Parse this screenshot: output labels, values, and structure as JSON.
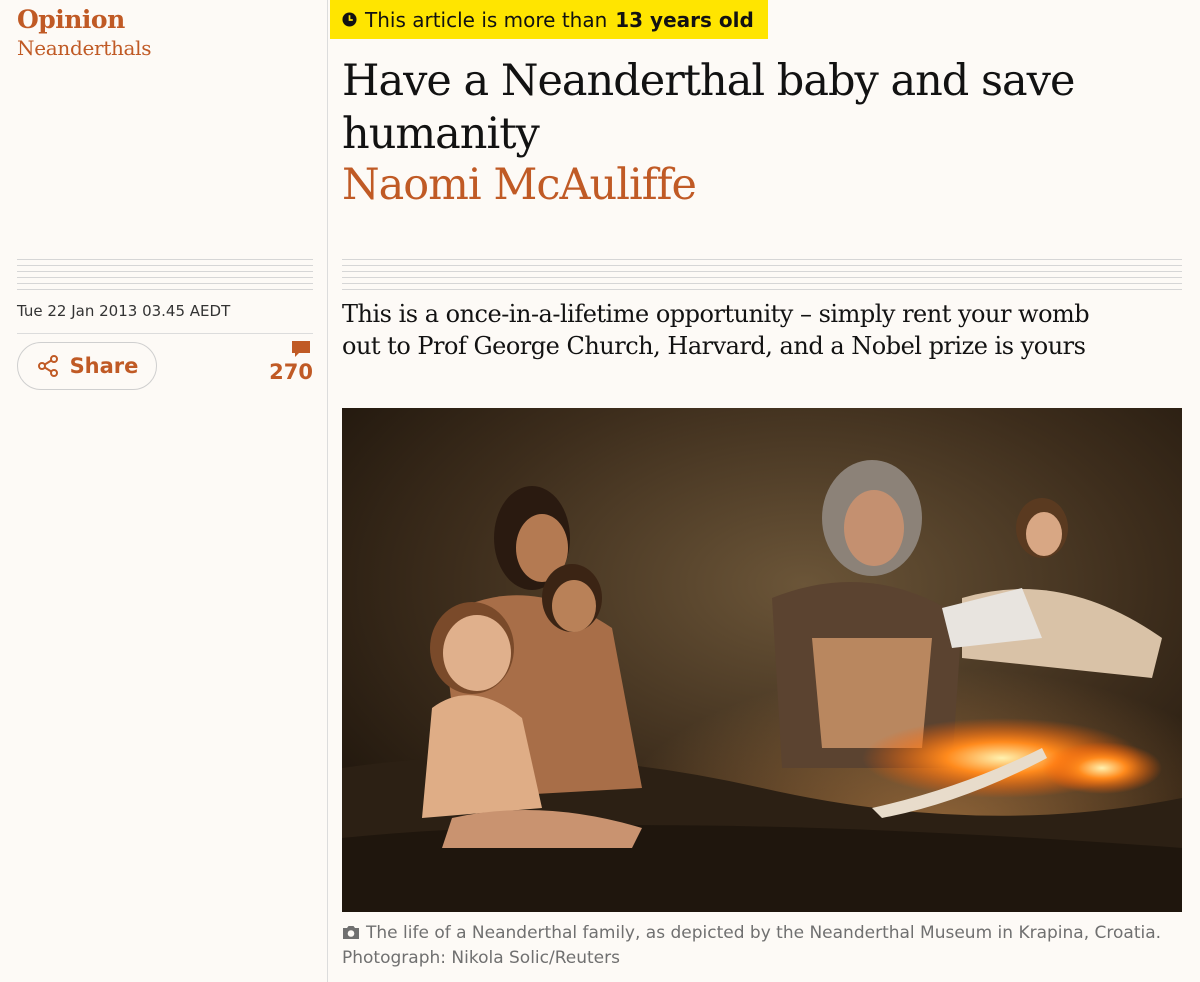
{
  "section": {
    "label": "Opinion",
    "series": "Neanderthals"
  },
  "age_notice": {
    "prefix": "This article is more than",
    "age": "13 years old",
    "icon": "clock-icon"
  },
  "article": {
    "headline": "Have a Neanderthal baby and save humanity",
    "byline": "Naomi McAuliffe",
    "dateline": "Tue 22 Jan 2013 03.45 AEDT",
    "standfirst": "This is a once-in-a-lifetime opportunity – simply rent your womb out to Prof George Church, Harvard, and a Nobel prize is yours"
  },
  "meta": {
    "share_label": "Share",
    "share_icon": "share-icon",
    "comment_count": "270",
    "comment_icon": "comment-icon"
  },
  "image": {
    "caption": "The life of a Neanderthal family, as depicted by the Neanderthal Museum in Krapina, Croatia.",
    "credit": "Photograph: Nikola Solic/Reuters",
    "caption_icon": "camera-icon"
  },
  "colors": {
    "accent": "#c05a25",
    "banner": "#ffe500",
    "background": "#fdfaf6",
    "text": "#121212",
    "muted": "#707070"
  }
}
